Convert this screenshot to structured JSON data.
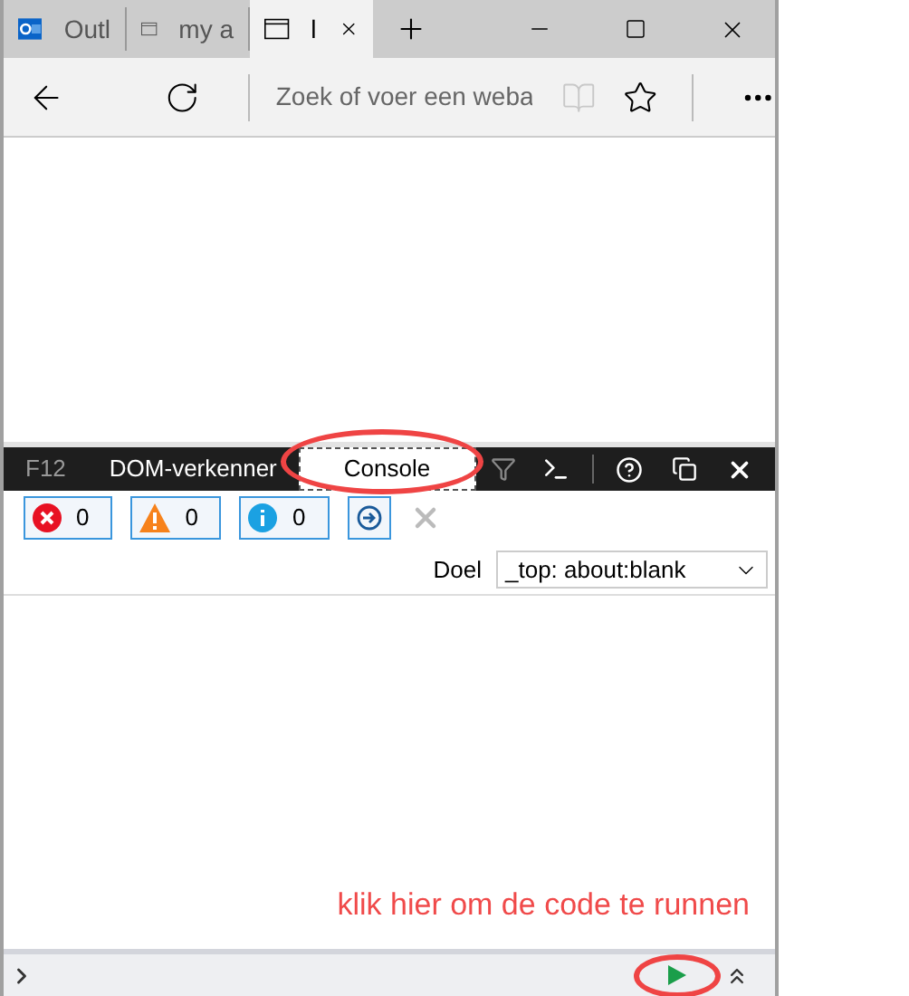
{
  "browser_tabs": [
    {
      "label": "Outl",
      "kind": "outlook",
      "selected": false
    },
    {
      "label": "my a",
      "kind": "page",
      "selected": false
    },
    {
      "label": "l",
      "kind": "page",
      "selected": true
    }
  ],
  "address_bar": {
    "placeholder": "Zoek of voer een weba"
  },
  "devtools": {
    "f12_label": "F12",
    "tools": [
      {
        "label": "DOM-verkenner",
        "selected": false
      },
      {
        "label": "Console",
        "selected": true
      }
    ],
    "filters": [
      {
        "kind": "error",
        "count": "0"
      },
      {
        "kind": "warning",
        "count": "0"
      },
      {
        "kind": "info",
        "count": "0"
      }
    ],
    "target": {
      "label": "Doel",
      "value": "_top: about:blank"
    }
  },
  "annotation": {
    "text": "klik hier om de code te runnen"
  }
}
